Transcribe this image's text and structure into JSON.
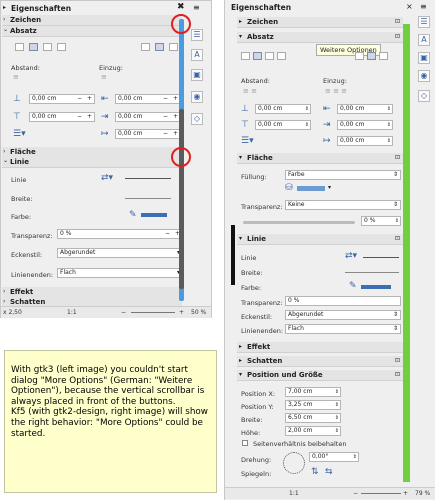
{
  "common": {
    "title": "Eigenschaften",
    "sec_zeichen": "Zeichen",
    "sec_absatz": "Absatz",
    "abstand": "Abstand:",
    "einzug": "Einzug:",
    "zero_cm": "0,00 cm",
    "sec_flaeche": "Fläche",
    "sec_linie": "Linie",
    "linie": "Linie",
    "breite": "Breite:",
    "farbe": "Farbe:",
    "transparenz": "Transparenz:",
    "transparenz_val": "0 %",
    "eckenstil": "Eckenstil:",
    "eckenstil_val": "Abgerundet",
    "linienenden": "Linienenden:",
    "linienenden_val": "Flach",
    "sec_effekt": "Effekt",
    "sec_schatten": "Schatten"
  },
  "left": {
    "status_zoom": "50 %",
    "status_pos": "x 2,50",
    "status_scale": "1:1"
  },
  "right": {
    "tooltip": "Weitere Optionen",
    "fuellung": "Füllung:",
    "fuellung_val": "Farbe",
    "transparenz_mode": "Keine",
    "transparenz_pct": "0 %",
    "sec_pos": "Position und Größe",
    "position_x": "Position X:",
    "position_x_val": "7,00 cm",
    "position_y": "Position Y:",
    "position_y_val": "3,25 cm",
    "breite_val": "6,50 cm",
    "hoehe": "Höhe:",
    "hoehe_val": "2,00 cm",
    "seitenverh": "Seitenverhältnis beibehalten",
    "drehung": "Drehung:",
    "drehung_val": "0,00°",
    "spiegeln": "Spiegeln:",
    "status_scale": "1:1",
    "status_zoom": "79 %"
  },
  "note": {
    "text": "With gtk3 (left image) you couldn't start dialog \"More Options\" (German: \"Weitere Optionen\"), because the vertical scrollbar is always placed in front of the buttons.\nKf5 (with gtk2-design, right image) will show the right behavior: \"More Options\" could be started."
  },
  "colors": {
    "accent_blue": "#3c6eb4",
    "scroll_green": "#6fcf3e",
    "note_bg": "#ffffcc",
    "circle_red": "#e02020"
  }
}
